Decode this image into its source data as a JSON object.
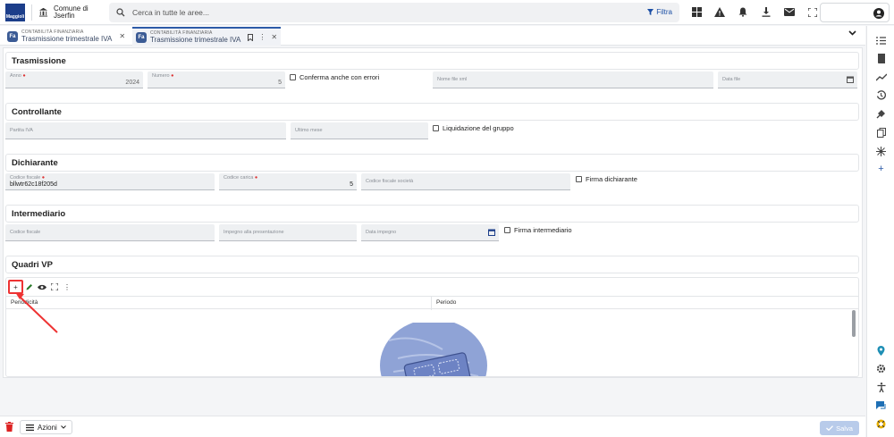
{
  "app": {
    "logo_text": "Maggioli",
    "org_name": "Comune di Jserfin"
  },
  "search": {
    "placeholder": "Cerca in tutte le aree...",
    "filter_label": "Filtra"
  },
  "tabs": [
    {
      "module": "CONTABILITÀ FINANZIARIA",
      "title": "Trasmissione trimestrale IVA",
      "badge": "Fa"
    },
    {
      "module": "CONTABILITÀ FINANZIARIA",
      "title": "Trasmissione trimestrale IVA",
      "badge": "Fa"
    }
  ],
  "sections": {
    "trasmissione": {
      "title": "Trasmissione",
      "anno_label": "Anno",
      "anno_value": "2024",
      "numero_label": "Numero",
      "numero_value": "5",
      "conferma_label": "Conferma anche con errori",
      "nome_file_label": "Nome file xml",
      "data_file_label": "Data file"
    },
    "controllante": {
      "title": "Controllante",
      "partita_iva_label": "Partita IVA",
      "ultimo_mese_label": "Ultimo mese",
      "liquidazione_label": "Liquidazione del gruppo"
    },
    "dichiarante": {
      "title": "Dichiarante",
      "codice_fiscale_label": "Codice fiscale",
      "codice_fiscale_value": "bllwtr62c18f205d",
      "codice_carica_label": "Codice carica",
      "codice_carica_value": "5",
      "cf_societa_label": "Codice fiscale società",
      "firma_label": "Firma dichiarante"
    },
    "intermediario": {
      "title": "Intermediario",
      "codice_fiscale_label": "Codice fiscale",
      "impegno_label": "Impegno alla presentazione",
      "data_impegno_label": "Data impegno",
      "firma_label": "Firma intermediario"
    },
    "quadri": {
      "title": "Quadri VP",
      "col_periodicita": "Periodicità",
      "col_periodo": "Periodo"
    }
  },
  "bottom": {
    "actions_label": "Azioni",
    "save_label": "Salva"
  },
  "colors": {
    "primary": "#2d5ba8",
    "highlight": "#e33333",
    "illustration": "#8fa3d6"
  }
}
